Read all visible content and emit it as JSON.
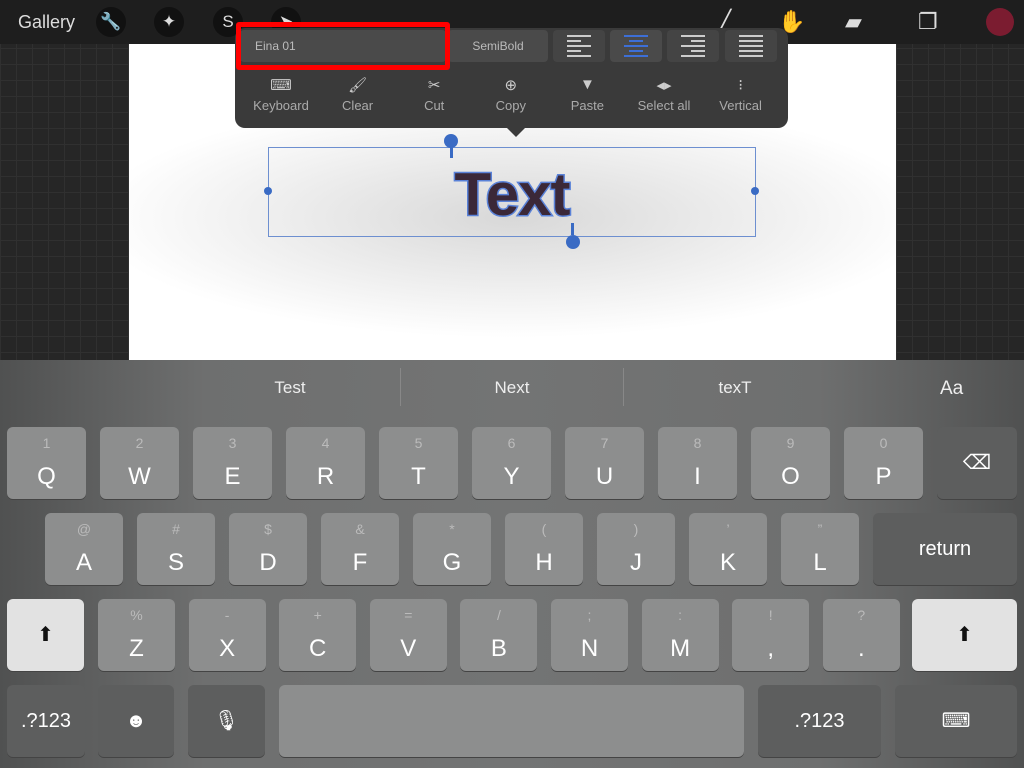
{
  "topbar": {
    "gallery": "Gallery",
    "tools": [
      "wrench-icon",
      "magic-wand-icon",
      "selection-icon",
      "transform-icon"
    ],
    "right_tools": [
      "brush-icon",
      "smudge-icon",
      "eraser-icon",
      "layers-icon"
    ],
    "current_color": "#7b1c30"
  },
  "popup": {
    "font": "Eina 01",
    "weight": "SemiBold",
    "align_selected": "center",
    "actions": [
      {
        "label": "Keyboard",
        "icon": "keyboard-icon",
        "glyph": "⌨"
      },
      {
        "label": "Clear",
        "icon": "brush-clear-icon",
        "glyph": "🖌"
      },
      {
        "label": "Cut",
        "icon": "scissors-icon",
        "glyph": "✂"
      },
      {
        "label": "Copy",
        "icon": "copy-icon",
        "glyph": "⊕"
      },
      {
        "label": "Paste",
        "icon": "paste-icon",
        "glyph": "▼"
      },
      {
        "label": "Select all",
        "icon": "select-all-icon",
        "glyph": "◂▸"
      },
      {
        "label": "Vertical",
        "icon": "vertical-icon",
        "glyph": "⁝"
      }
    ]
  },
  "canvas": {
    "text": "Text"
  },
  "keyboard": {
    "suggestions": [
      "Test",
      "Next",
      "texT"
    ],
    "format_label": "Aa",
    "row1": [
      [
        "1",
        "Q"
      ],
      [
        "2",
        "W"
      ],
      [
        "3",
        "E"
      ],
      [
        "4",
        "R"
      ],
      [
        "5",
        "T"
      ],
      [
        "6",
        "Y"
      ],
      [
        "7",
        "U"
      ],
      [
        "8",
        "I"
      ],
      [
        "9",
        "O"
      ],
      [
        "0",
        "P"
      ]
    ],
    "row2": [
      [
        "@",
        "A"
      ],
      [
        "#",
        "S"
      ],
      [
        "$",
        "D"
      ],
      [
        "&",
        "F"
      ],
      [
        "*",
        "G"
      ],
      [
        "(",
        "H"
      ],
      [
        ")",
        "J"
      ],
      [
        "’",
        "K"
      ],
      [
        "”",
        "L"
      ]
    ],
    "row3": [
      [
        "%",
        "Z"
      ],
      [
        "-",
        "X"
      ],
      [
        "+",
        "C"
      ],
      [
        "=",
        "V"
      ],
      [
        "/",
        "B"
      ],
      [
        ";",
        "N"
      ],
      [
        ":",
        "M"
      ],
      [
        "!",
        ","
      ],
      [
        "?",
        "."
      ]
    ],
    "return": "return",
    "numbers": ".?123",
    "delete_glyph": "⌫",
    "shift_glyph": "⬆",
    "emoji_glyph": "☻",
    "mic_glyph": "🎙",
    "hide_glyph": "⌨"
  }
}
